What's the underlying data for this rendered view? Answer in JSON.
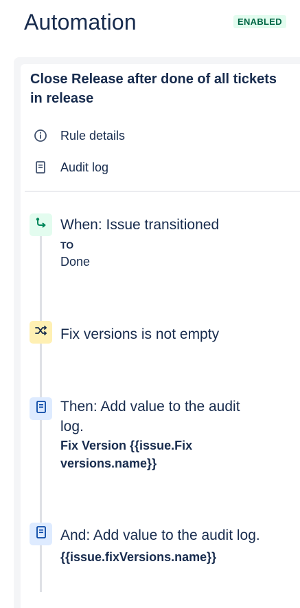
{
  "header": {
    "title": "Automation",
    "status": "ENABLED"
  },
  "rule": {
    "title": "Close Release after done of all tickets in release"
  },
  "menu": {
    "items": [
      {
        "label": "Rule details",
        "icon": "info-icon"
      },
      {
        "label": "Audit log",
        "icon": "document-icon"
      }
    ]
  },
  "steps": [
    {
      "type": "trigger",
      "icon": "transition-icon",
      "title": "When: Issue transitioned",
      "sub_label": "TO",
      "sub_value": "Done",
      "icon_bg": "#e3fcef",
      "icon_color": "#00875a"
    },
    {
      "type": "condition",
      "icon": "shuffle-icon",
      "title": "Fix versions is not empty",
      "icon_bg": "#fff0b3",
      "icon_color": "#172b4d"
    },
    {
      "type": "action",
      "icon": "document-icon",
      "title": "Then: Add value to the audit log.",
      "detail": "Fix Version {{issue.Fix versions.name}}",
      "icon_bg": "#deebff",
      "icon_color": "#0747a6"
    },
    {
      "type": "action",
      "icon": "document-icon",
      "title": "And: Add value to the audit log.",
      "detail": "{{issue.fixVersions.name}}",
      "icon_bg": "#deebff",
      "icon_color": "#0747a6"
    }
  ],
  "colors": {
    "text": "#172b4d",
    "badge_bg": "#e3fcef",
    "badge_text": "#006644",
    "panel_bg": "#f4f5f7",
    "timeline": "#dfe1e6"
  }
}
